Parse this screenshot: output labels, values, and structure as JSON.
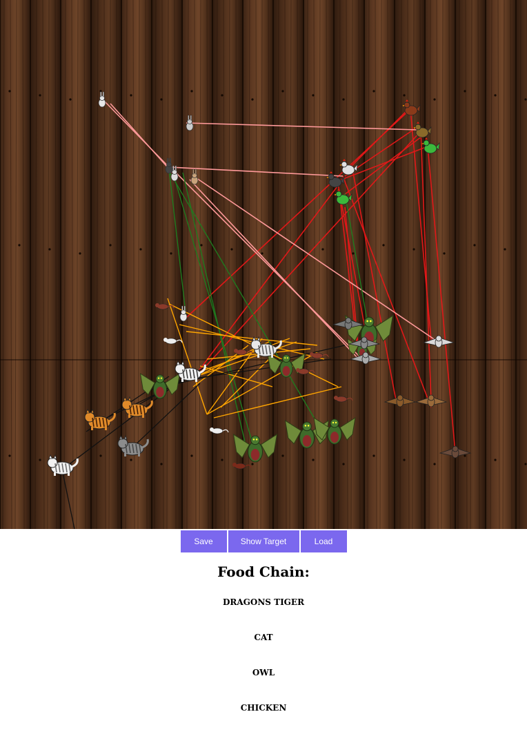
{
  "toolbar": {
    "save_label": "Save",
    "show_target_label": "Show Target",
    "load_label": "Load",
    "accent_color": "#7b68ee"
  },
  "food_chain": {
    "title": "Food Chain:",
    "levels": [
      "DRAGONS TIGER",
      "CAT",
      "OWL",
      "CHICKEN"
    ]
  },
  "board": {
    "background": "wood-planks",
    "creatures": [
      "dragon",
      "tiger",
      "cat",
      "owl",
      "chicken",
      "rabbit",
      "mouse",
      "rat"
    ],
    "line_colors": {
      "chicken_targets": "#e01818",
      "owl_targets": "#ff9a9a",
      "dragon_targets": "#1f7a1f",
      "tiger_targets": "#ffa500",
      "cat_targets": "#111111"
    }
  }
}
